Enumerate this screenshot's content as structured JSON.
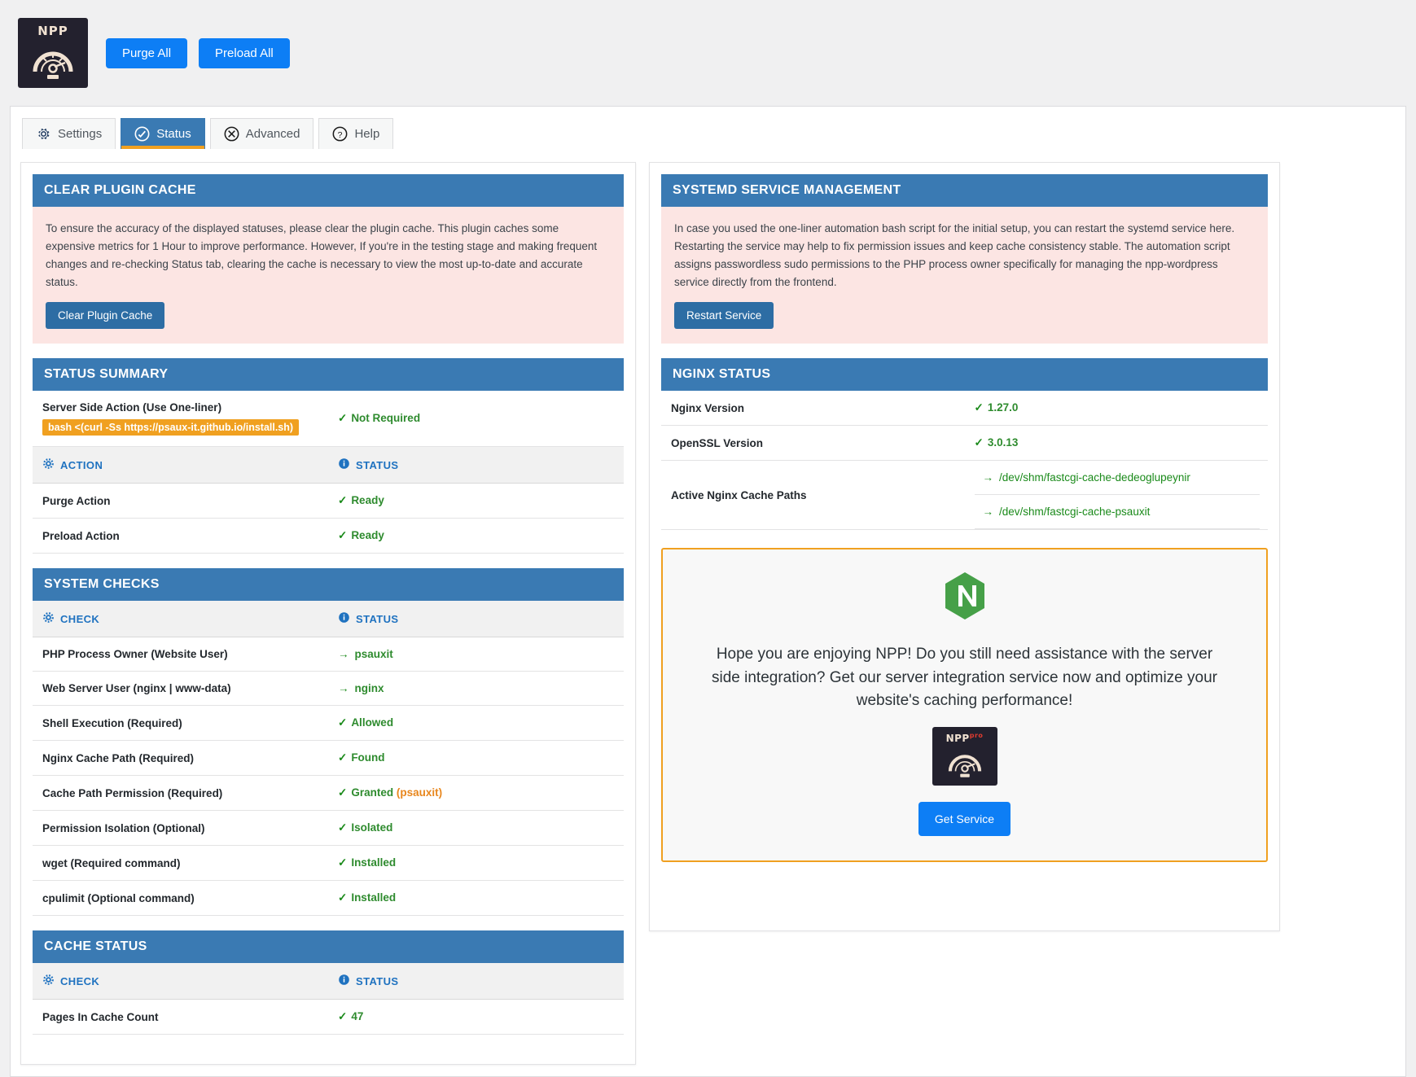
{
  "header": {
    "logo_text": "NPP",
    "purge_all_label": "Purge All",
    "preload_all_label": "Preload All"
  },
  "tabs": [
    {
      "label": "Settings",
      "icon": "gear-icon",
      "active": false
    },
    {
      "label": "Status",
      "icon": "status-check-icon",
      "active": true
    },
    {
      "label": "Advanced",
      "icon": "tools-icon",
      "active": false
    },
    {
      "label": "Help",
      "icon": "question-icon",
      "active": false
    }
  ],
  "left": {
    "clear_plugin_cache": {
      "title": "CLEAR PLUGIN CACHE",
      "body": "To ensure the accuracy of the displayed statuses, please clear the plugin cache. This plugin caches some expensive metrics for 1 Hour to improve performance. However, If you're in the testing stage and making frequent changes and re-checking Status tab, clearing the cache is necessary to view the most up-to-date and accurate status.",
      "button_label": "Clear Plugin Cache"
    },
    "status_summary": {
      "title": "STATUS SUMMARY",
      "server_side_action_label": "Server Side Action (Use One-liner)",
      "one_liner": "bash <(curl -Ss https://psaux-it.github.io/install.sh)",
      "server_side_action_status": "Not Required",
      "col_action": "ACTION",
      "col_status": "STATUS",
      "rows": [
        {
          "label": "Purge Action",
          "status": "Ready"
        },
        {
          "label": "Preload Action",
          "status": "Ready"
        }
      ]
    },
    "system_checks": {
      "title": "SYSTEM CHECKS",
      "col_check": "CHECK",
      "col_status": "STATUS",
      "rows": [
        {
          "label": "PHP Process Owner (Website User)",
          "status": "psauxit",
          "marker": "arrow",
          "extra": ""
        },
        {
          "label": "Web Server User (nginx | www-data)",
          "status": "nginx",
          "marker": "arrow",
          "extra": ""
        },
        {
          "label": "Shell Execution (Required)",
          "status": "Allowed",
          "marker": "check",
          "extra": ""
        },
        {
          "label": "Nginx Cache Path (Required)",
          "status": "Found",
          "marker": "check",
          "extra": ""
        },
        {
          "label": "Cache Path Permission (Required)",
          "status": "Granted",
          "marker": "check",
          "extra": "(psauxit)"
        },
        {
          "label": "Permission Isolation (Optional)",
          "status": "Isolated",
          "marker": "check",
          "extra": ""
        },
        {
          "label": "wget (Required command)",
          "status": "Installed",
          "marker": "check",
          "extra": ""
        },
        {
          "label": "cpulimit (Optional command)",
          "status": "Installed",
          "marker": "check",
          "extra": ""
        }
      ]
    },
    "cache_status": {
      "title": "CACHE STATUS",
      "col_check": "CHECK",
      "col_status": "STATUS",
      "rows": [
        {
          "label": "Pages In Cache Count",
          "status": "47"
        }
      ]
    }
  },
  "right": {
    "systemd": {
      "title": "SYSTEMD SERVICE MANAGEMENT",
      "body": "In case you used the one-liner automation bash script for the initial setup, you can restart the systemd service here. Restarting the service may help to fix permission issues and keep cache consistency stable. The automation script assigns passwordless sudo permissions to the PHP process owner specifically for managing the npp-wordpress service directly from the frontend.",
      "button_label": "Restart Service"
    },
    "nginx_status": {
      "title": "NGINX STATUS",
      "rows": [
        {
          "label": "Nginx Version",
          "status": "1.27.0"
        },
        {
          "label": "OpenSSL Version",
          "status": "3.0.13"
        }
      ],
      "cache_paths_label": "Active Nginx Cache Paths",
      "cache_paths": [
        "/dev/shm/fastcgi-cache-dedeoglupeynir",
        "/dev/shm/fastcgi-cache-psauxit"
      ]
    },
    "promo": {
      "nginx_logo": "nginx-n-icon",
      "text": "Hope you are enjoying NPP! Do you still need assistance with the server side integration? Get our server integration service now and optimize your website's caching performance!",
      "badge_text": "NPP",
      "badge_sup": "pro",
      "button_label": "Get Service"
    }
  },
  "colors": {
    "accent_blue": "#0d7ef5",
    "header_blue": "#3a7ab3",
    "notice_pink": "#fce5e3",
    "ok_green": "#1a8a1a",
    "orange": "#f0a020",
    "nginx_green": "#46a048"
  }
}
